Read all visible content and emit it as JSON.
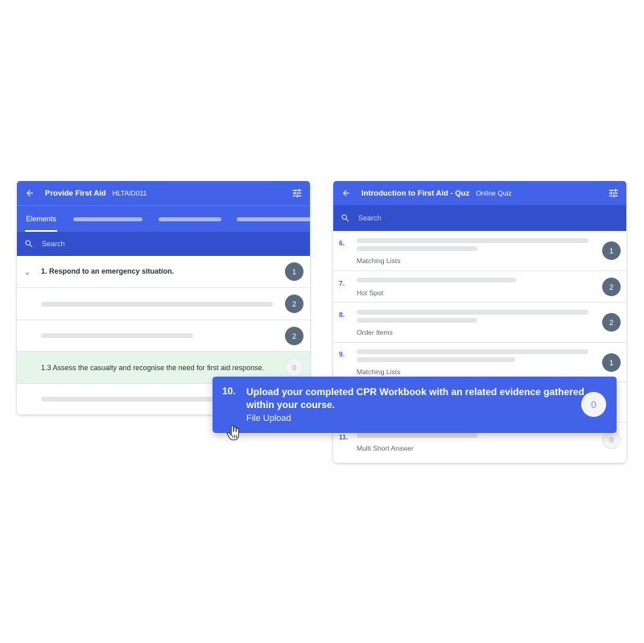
{
  "left_panel": {
    "title": "Provide First Aid",
    "code": "HLTAID011",
    "active_tab": "Elements",
    "search_placeholder": "Search",
    "element_1": {
      "label": "1. Respond to an emergency situation.",
      "count": "1"
    },
    "row_2_count": "2",
    "row_3_count": "2",
    "element_13": {
      "label": "1.3 Assess the casualty and recognise the need for first aid response.",
      "count": "0"
    }
  },
  "right_panel": {
    "title": "Introduction to First Aid - Quz",
    "subtitle": "Online Quiz",
    "search_placeholder": "Search",
    "questions": [
      {
        "num": "6.",
        "type": "Matching Lists",
        "count": "1"
      },
      {
        "num": "7.",
        "type": "Hot Spot",
        "count": "2"
      },
      {
        "num": "8.",
        "type": "Order Items",
        "count": "2"
      },
      {
        "num": "9.",
        "type": "Matching Lists",
        "count": "1"
      },
      {
        "num": "11.",
        "type": "Multi Short Answer",
        "count": "0"
      }
    ]
  },
  "popup": {
    "num": "10.",
    "title": "Upload your completed CPR Workbook with an related evidence gathered within your course.",
    "type": "File Upload",
    "count": "0"
  },
  "colors": {
    "primary": "#4262e8",
    "search_bar": "#3350cc",
    "badge": "#5a6b7d",
    "highlight_row": "#e6f5ea"
  },
  "icons": [
    "arrow-back-icon",
    "filter-sliders-icon",
    "search-icon",
    "chevron-down-icon",
    "hand-cursor-icon"
  ]
}
